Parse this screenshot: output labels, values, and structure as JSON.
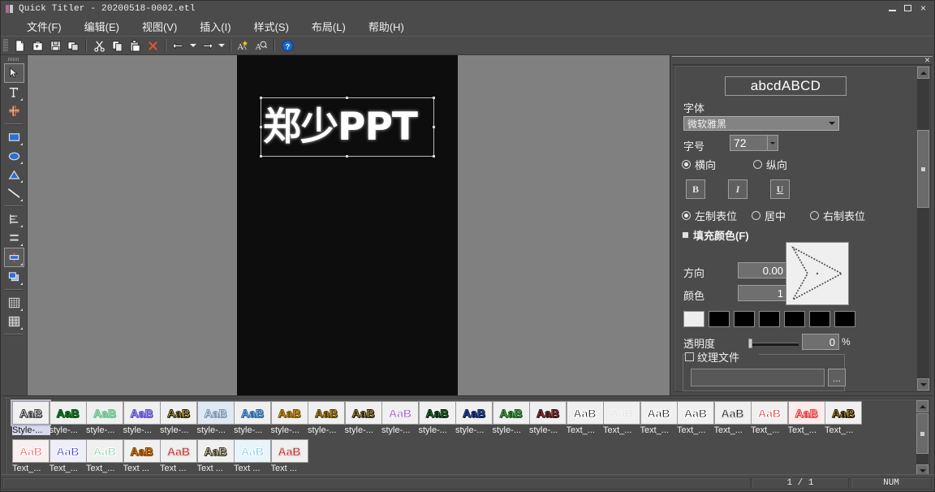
{
  "window": {
    "title": "Quick Titler - 20200518-0002.etl",
    "icon": "app-icon",
    "buttons": {
      "minimize": "minimize",
      "maximize": "maximize",
      "close": "×"
    }
  },
  "menubar": {
    "items": [
      {
        "label": "文件(F)",
        "name": "menu-file"
      },
      {
        "label": "编辑(E)",
        "name": "menu-edit"
      },
      {
        "label": "视图(V)",
        "name": "menu-view"
      },
      {
        "label": "插入(I)",
        "name": "menu-insert"
      },
      {
        "label": "样式(S)",
        "name": "menu-style"
      },
      {
        "label": "布局(L)",
        "name": "menu-layout"
      },
      {
        "label": "帮助(H)",
        "name": "menu-help"
      }
    ]
  },
  "toolbar": {
    "buttons": [
      {
        "icon": "new-document-icon"
      },
      {
        "icon": "open-folder-icon"
      },
      {
        "icon": "save-icon"
      },
      {
        "icon": "save-as-icon"
      },
      {
        "icon": "cut-scissors-icon"
      },
      {
        "icon": "copy-icon"
      },
      {
        "icon": "paste-icon"
      },
      {
        "icon": "delete-x-icon"
      },
      {
        "icon": "undo-icon"
      },
      {
        "icon": "redo-icon"
      },
      {
        "icon": "style-wizard-icon"
      },
      {
        "icon": "font-lookup-icon"
      },
      {
        "icon": "help-question-icon"
      }
    ]
  },
  "tool_rail": {
    "tools": [
      {
        "name": "select-arrow-tool",
        "icon": "cursor-arrow-icon",
        "selected": true
      },
      {
        "name": "text-tool",
        "icon": "text-t-icon",
        "selected": false
      },
      {
        "name": "crosshair-tool",
        "icon": "crosshair-icon",
        "selected": false
      },
      {
        "name": "rectangle-tool",
        "icon": "rectangle-icon",
        "selected": false
      },
      {
        "name": "ellipse-tool",
        "icon": "ellipse-icon",
        "selected": false
      },
      {
        "name": "triangle-tool",
        "icon": "triangle-icon",
        "selected": false
      },
      {
        "name": "line-tool",
        "icon": "line-icon",
        "selected": false
      },
      {
        "name": "align-left-tool",
        "icon": "align-objects-icon",
        "selected": false
      },
      {
        "name": "distribute-tool",
        "icon": "distribute-icon",
        "selected": false
      },
      {
        "name": "center-object-tool",
        "icon": "center-object-icon",
        "selected": true
      },
      {
        "name": "arrange-order-tool",
        "icon": "arrange-order-icon",
        "selected": false
      },
      {
        "name": "grid-tool",
        "icon": "grid-icon",
        "selected": false
      },
      {
        "name": "table-tool",
        "icon": "table-icon",
        "selected": false
      }
    ]
  },
  "canvas": {
    "text": "郑少PPT",
    "background_color": "#0d0d0d",
    "surround_color": "#808080",
    "text_color": "#ffffff"
  },
  "properties": {
    "close_label": "✕",
    "preview_text": "abcdABCD",
    "font_label": "字体",
    "font_value": "微软雅黑",
    "size_label": "字号",
    "size_value": "72",
    "orientation": {
      "horizontal": "横向",
      "vertical": "纵向",
      "selected": "horizontal"
    },
    "style_buttons": {
      "bold": "B",
      "italic": "I",
      "underline": "U"
    },
    "alignment": {
      "left": "左制表位",
      "center": "居中",
      "right": "右制表位",
      "selected": "left"
    },
    "fill_section": {
      "title": "填充颜色(F)",
      "direction_label": "方向",
      "direction_value": "0.00",
      "color_label": "颜色",
      "color_value": "1",
      "swatches": [
        "#eeeeee",
        "#000000",
        "#000000",
        "#000000",
        "#000000",
        "#000000",
        "#000000"
      ],
      "opacity_label": "透明度",
      "opacity_value": "0",
      "opacity_unit": "%",
      "texture_label": "纹理文件",
      "texture_path": "",
      "texture_browse": "..."
    }
  },
  "gallery": {
    "close_label": "✕",
    "items": [
      {
        "label": "Style-...",
        "text": "AaB",
        "fg": "#f2f2f2",
        "stroke": "#3a3a3a",
        "bg": "#f0f0f0",
        "selected": true
      },
      {
        "label": "style-...",
        "text": "AaB",
        "fg": "#128a2b",
        "stroke": "#0a4d18",
        "bg": "#f0f0f0",
        "selected": false
      },
      {
        "label": "style-...",
        "text": "AaB",
        "fg": "#a8dcbb",
        "stroke": "#6fbf8d",
        "bg": "#f0f0f0",
        "selected": false
      },
      {
        "label": "style-...",
        "text": "AaB",
        "fg": "#b0a8ef",
        "stroke": "#5b4fc2",
        "bg": "#f0f0f0",
        "selected": false
      },
      {
        "label": "style-...",
        "text": "AaB",
        "fg": "#e3c312",
        "stroke": "#1a1a1a",
        "bg": "#f0f0f0",
        "selected": false
      },
      {
        "label": "style-...",
        "text": "AaB",
        "fg": "#e8f2fb",
        "stroke": "#7f93a8",
        "bg": "#dfe9f4",
        "selected": false
      },
      {
        "label": "style-...",
        "text": "AaB",
        "fg": "#8fc6ee",
        "stroke": "#2a5f94",
        "bg": "#f0f0f0",
        "selected": false
      },
      {
        "label": "style-...",
        "text": "AaB",
        "fg": "#e8a81c",
        "stroke": "#6b4a06",
        "bg": "#f0f0f0",
        "selected": false
      },
      {
        "label": "style-...",
        "text": "AaB",
        "fg": "#e0a81e",
        "stroke": "#4a3405",
        "bg": "#f0f0f0",
        "selected": false
      },
      {
        "label": "style-...",
        "text": "AaB",
        "fg": "#e0b01c",
        "stroke": "#1a1a1a",
        "bg": "#f0f0f0",
        "selected": false
      },
      {
        "label": "style-...",
        "text": "AaB",
        "fg": "#9b34d6",
        "stroke": "#f0f0f0",
        "bg": "#f0f0f0",
        "selected": false
      },
      {
        "label": "style-...",
        "text": "AaB",
        "fg": "#1a8f2e",
        "stroke": "#0e1a0e",
        "bg": "#f0f0f0",
        "selected": false
      },
      {
        "label": "style-...",
        "text": "AaB",
        "fg": "#2050d8",
        "stroke": "#101a3a",
        "bg": "#f0f0f0",
        "selected": false
      },
      {
        "label": "style-...",
        "text": "AaB",
        "fg": "#4fbf52",
        "stroke": "#1c4c1e",
        "bg": "#f0f0f0",
        "selected": false
      },
      {
        "label": "style-...",
        "text": "AaB",
        "fg": "#e02424",
        "stroke": "#1a1a1a",
        "bg": "#f0f0f0",
        "selected": false
      },
      {
        "label": "Text_...",
        "text": "AaB",
        "fg": "#1a1a1a",
        "stroke": "#ffffff",
        "bg": "#f0f0f0",
        "selected": false
      },
      {
        "label": "Text_...",
        "text": "AaB",
        "fg": "#e0e0e0",
        "stroke": "#f5f5f5",
        "bg": "#f0f0f0",
        "selected": false
      },
      {
        "label": "Text_...",
        "text": "AaB",
        "fg": "#111111",
        "stroke": "#ffffff",
        "bg": "#f0f0f0",
        "selected": false
      },
      {
        "label": "Text_...",
        "text": "AaB",
        "fg": "#101010",
        "stroke": "#ffffff",
        "bg": "#f0f0f0",
        "selected": false
      },
      {
        "label": "Text_...",
        "text": "AaB",
        "fg": "#111111",
        "stroke": "#dddddd",
        "bg": "#f0f0f0",
        "selected": false
      },
      {
        "label": "Text_...",
        "text": "AaB",
        "fg": "#d92020",
        "stroke": "#ffffff",
        "bg": "#f0f0f0",
        "selected": false
      },
      {
        "label": "Text_...",
        "text": "AaB",
        "fg": "#fbd9d9",
        "stroke": "#e04040",
        "bg": "#fdecec",
        "selected": false
      },
      {
        "label": "Text_...",
        "text": "AaB",
        "fg": "#e0a800",
        "stroke": "#111111",
        "bg": "#f0f0f0",
        "selected": false
      },
      {
        "label": "Text_...",
        "text": "AaB",
        "fg": "#f24a4a",
        "stroke": "#ffffff",
        "bg": "#f8f0f0",
        "selected": false
      },
      {
        "label": "Text_...",
        "text": "AaB",
        "fg": "#2525e0",
        "stroke": "#ffffff",
        "bg": "#eeeef8",
        "selected": false
      },
      {
        "label": "Text_...",
        "text": "AaB",
        "fg": "#7cc8a0",
        "stroke": "#ffffff",
        "bg": "#f0f0f0",
        "selected": false
      },
      {
        "label": "Text ...",
        "text": "AaB",
        "fg": "#f08a22",
        "stroke": "#7a3d05",
        "bg": "#f0f0f0",
        "selected": false
      },
      {
        "label": "Text ...",
        "text": "AaB",
        "fg": "#9c1414",
        "stroke": "#f0c8c8",
        "bg": "#f0f0f0",
        "selected": false
      },
      {
        "label": "Text ...",
        "text": "AaB",
        "fg": "#f2ead0",
        "stroke": "#3a3424",
        "bg": "#f0f0f0",
        "selected": false
      },
      {
        "label": "Text ...",
        "text": "AaB",
        "fg": "#5ec4ec",
        "stroke": "#ffffff",
        "bg": "#e8f4fb",
        "selected": false
      },
      {
        "label": "Text ...",
        "text": "AaB",
        "fg": "#a81818",
        "stroke": "#eec8c8",
        "bg": "#f0f0f0",
        "selected": false
      }
    ]
  },
  "statusbar": {
    "main": "",
    "page": "1 / 1",
    "num": "NUM"
  }
}
